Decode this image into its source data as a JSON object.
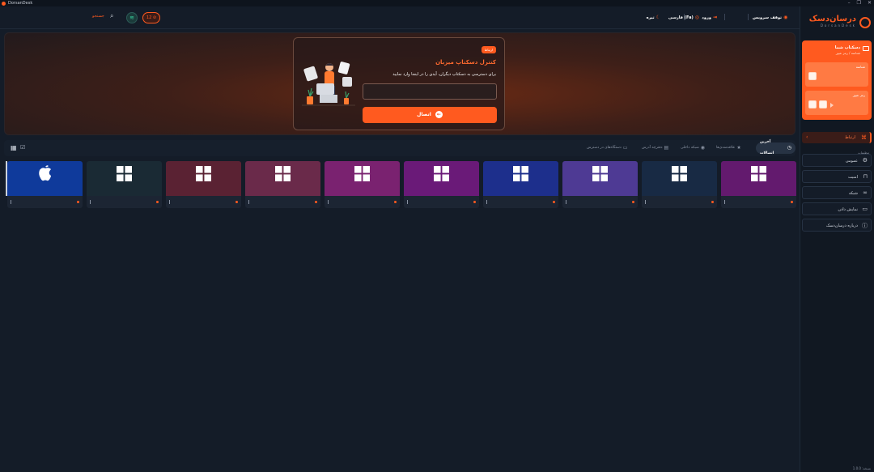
{
  "app": {
    "title": "DorsanDesk"
  },
  "window": {
    "minimize": "–",
    "maximize": "❐",
    "close": "✕"
  },
  "topbar": {
    "search_label": "جستجو",
    "alert_count": "12",
    "stop_service": "توقف سرویس",
    "theme": "تیره",
    "language": "فارسی (Fa)",
    "login": "ورود"
  },
  "sidebar": {
    "brand_name": "درسان‌دسک",
    "brand_sub": "DorsanDesk",
    "your_desktop": {
      "title": "دسکتاپ شما",
      "subtitle": "شناسه / رمز عبور",
      "id_label": "شناسه",
      "password_label": "رمز عبور"
    },
    "connect_label": "ارتباط",
    "settings_header": "تنظیمات",
    "settings_items": [
      {
        "label": "عمومی",
        "icon": "gear-icon"
      },
      {
        "label": "امنیت",
        "icon": "lock-icon"
      },
      {
        "label": "شبکه",
        "icon": "network-icon"
      },
      {
        "label": "نمایش دادن",
        "icon": "display-icon"
      },
      {
        "label": "درباره درسان‌دسک",
        "icon": "info-icon"
      }
    ],
    "version": "نسخه: 1.0.0"
  },
  "hero": {
    "badge": "ارتباط",
    "title": "کنترل دسکتاپ میزبان",
    "description": "برای دسترسی به دسکتاپ دیگران، آیدی را در اینجا وارد نمایید",
    "input_placeholder": "",
    "connect_label": "اتصال"
  },
  "tabs": [
    {
      "label": "آخرین اتصالات",
      "icon": "clock-icon",
      "active": true
    },
    {
      "label": "علاقه‌مندی‌ها",
      "icon": "star-icon",
      "active": false
    },
    {
      "label": "شبکه داخلی",
      "icon": "compass-icon",
      "active": false
    },
    {
      "label": "دفترچه آدرس",
      "icon": "book-icon",
      "active": false
    },
    {
      "label": "دستگاه‌های در دسترس",
      "icon": "devices-icon",
      "active": false
    }
  ],
  "devices": [
    {
      "os": "apple",
      "color": "#0f3a9b",
      "name": ""
    },
    {
      "os": "windows",
      "color": "#1a2a34",
      "name": ""
    },
    {
      "os": "windows",
      "color": "#5a2233",
      "name": ""
    },
    {
      "os": "windows",
      "color": "#6a2a4a",
      "name": ""
    },
    {
      "os": "windows",
      "color": "#7a2270",
      "name": ""
    },
    {
      "os": "windows",
      "color": "#6a1a78",
      "name": ""
    },
    {
      "os": "windows",
      "color": "#1d2f8c",
      "name": ""
    },
    {
      "os": "windows",
      "color": "#4e3a94",
      "name": ""
    },
    {
      "os": "windows",
      "color": "#182a44",
      "name": ""
    },
    {
      "os": "windows",
      "color": "#631a6e",
      "name": ""
    }
  ],
  "colors": {
    "accent": "#ff5a1f",
    "background": "#141c28",
    "sidebar": "#111822"
  }
}
